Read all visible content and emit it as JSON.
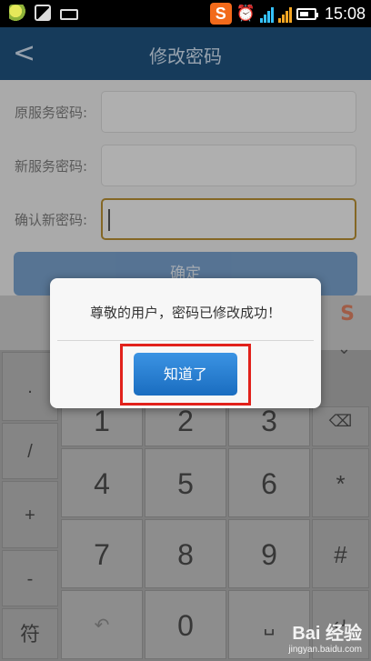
{
  "status_bar": {
    "time": "15:08",
    "sogou_label": "S",
    "icons": [
      "notification-leaf-icon",
      "image-icon",
      "keyboard-icon",
      "sogou-icon",
      "alarm-icon",
      "signal-icon",
      "battery-icon"
    ]
  },
  "header": {
    "back_glyph": "<",
    "title": "修改密码"
  },
  "form": {
    "fields": [
      {
        "label": "原服务密码:",
        "value": ""
      },
      {
        "label": "新服务密码:",
        "value": ""
      },
      {
        "label": "确认新密码:",
        "value": ""
      }
    ],
    "confirm_label": "确定"
  },
  "keyboard": {
    "side_keys": [
      ".",
      "/",
      "+",
      "-",
      "符"
    ],
    "digits": [
      "1",
      "2",
      "3",
      "4",
      "5",
      "6",
      "7",
      "8",
      "9",
      "0"
    ],
    "right_keys": [
      "*",
      "#"
    ],
    "logo": "S"
  },
  "dialog": {
    "message": "尊敬的用户，密码已修改成功！",
    "ok_label": "知道了"
  },
  "watermark": {
    "logo": "Bai 经验",
    "url": "jingyan.baidu.com"
  },
  "colors": {
    "header": "#1e4f7a",
    "dialog_button": "#1a6dc0",
    "highlight_box": "#e1211b",
    "sogou": "#f26a1b"
  }
}
